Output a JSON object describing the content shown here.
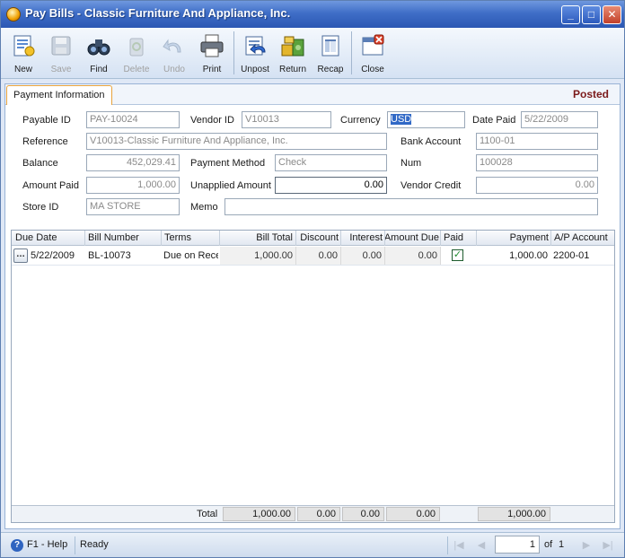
{
  "window": {
    "title": "Pay Bills - Classic Furniture And Appliance, Inc."
  },
  "toolbar": {
    "new": "New",
    "save": "Save",
    "find": "Find",
    "delete": "Delete",
    "undo": "Undo",
    "print": "Print",
    "unpost": "Unpost",
    "return": "Return",
    "recap": "Recap",
    "close": "Close"
  },
  "tab": {
    "label": "Payment Information",
    "status": "Posted"
  },
  "form": {
    "payable_id_label": "Payable ID",
    "payable_id": "PAY-10024",
    "vendor_id_label": "Vendor ID",
    "vendor_id": "V10013",
    "currency_label": "Currency",
    "currency": "USD",
    "date_paid_label": "Date Paid",
    "date_paid": "5/22/2009",
    "reference_label": "Reference",
    "reference": "V10013-Classic Furniture And Appliance, Inc.",
    "bank_account_label": "Bank Account",
    "bank_account": "1100-01",
    "balance_label": "Balance",
    "balance": "452,029.41",
    "payment_method_label": "Payment Method",
    "payment_method": "Check",
    "num_label": "Num",
    "num": "100028",
    "amount_paid_label": "Amount Paid",
    "amount_paid": "1,000.00",
    "unapplied_amount_label": "Unapplied Amount",
    "unapplied_amount": "0.00",
    "vendor_credit_label": "Vendor Credit",
    "vendor_credit": "0.00",
    "store_id_label": "Store ID",
    "store_id": "MA STORE",
    "memo_label": "Memo",
    "memo": ""
  },
  "grid": {
    "headers": {
      "due_date": "Due Date",
      "bill_number": "Bill Number",
      "terms": "Terms",
      "bill_total": "Bill Total",
      "discount": "Discount",
      "interest": "Interest",
      "amount_due": "Amount Due",
      "paid": "Paid",
      "payment": "Payment",
      "ap_account": "A/P Account"
    },
    "rows": [
      {
        "due_date": "5/22/2009",
        "bill_number": "BL-10073",
        "terms": "Due on Receipt",
        "bill_total": "1,000.00",
        "discount": "0.00",
        "interest": "0.00",
        "amount_due": "0.00",
        "paid": true,
        "payment": "1,000.00",
        "ap_account": "2200-01"
      }
    ],
    "footer": {
      "label": "Total",
      "bill_total": "1,000.00",
      "discount": "0.00",
      "interest": "0.00",
      "amount_due": "0.00",
      "payment": "1,000.00"
    }
  },
  "statusbar": {
    "help": "F1 - Help",
    "status": "Ready",
    "page": "1",
    "of_label": "of",
    "total_pages": "1"
  }
}
